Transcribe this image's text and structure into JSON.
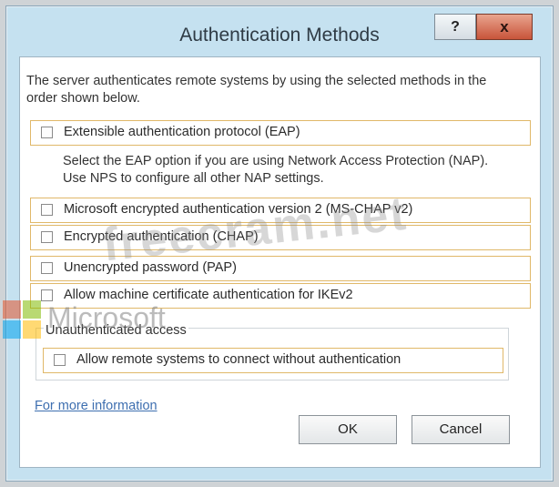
{
  "window": {
    "title": "Authentication Methods",
    "help_button": "?",
    "close_button": "x"
  },
  "intro_text": "The server authenticates remote systems by using the selected methods in the order shown below.",
  "options": [
    {
      "label": "Extensible authentication protocol (EAP)",
      "checked": false
    },
    {
      "label": "Microsoft encrypted authentication version 2 (MS-CHAP v2)",
      "checked": false
    },
    {
      "label": "Encrypted authentication (CHAP)",
      "checked": false
    },
    {
      "label": "Unencrypted password (PAP)",
      "checked": false
    },
    {
      "label": "Allow machine certificate authentication for IKEv2",
      "checked": false
    }
  ],
  "eap_note": "Select the EAP option if you are using Network Access Protection (NAP). Use NPS to configure all other NAP settings.",
  "unauthenticated": {
    "caption": "Unauthenticated access",
    "option_label": "Allow remote systems to connect without authentication",
    "checked": false
  },
  "link": "For more information",
  "buttons": {
    "ok": "OK",
    "cancel": "Cancel"
  },
  "watermark": {
    "site": "freecram.net",
    "brand": "Microsoft"
  },
  "colors": {
    "frame": "#c5e1f0",
    "option_border": "#e0b869",
    "link": "#3e6fb0",
    "close": "#c8543a"
  }
}
